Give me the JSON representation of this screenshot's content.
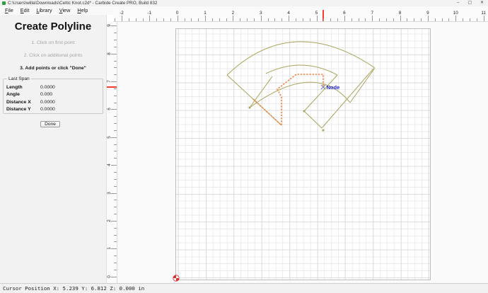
{
  "window": {
    "title": "C:\\Users\\willa\\Downloads\\Celtic Knot.c2d* - Carbide Create PRO, Build 832",
    "minimize_glyph": "–",
    "maximize_glyph": "▢",
    "close_glyph": "✕"
  },
  "menu": {
    "items": [
      {
        "label": "File"
      },
      {
        "label": "Edit"
      },
      {
        "label": "Library"
      },
      {
        "label": "View"
      },
      {
        "label": "Help"
      }
    ]
  },
  "panel": {
    "title": "Create Polyline",
    "steps": [
      {
        "label": "1. Click on first point"
      },
      {
        "label": "2. Click on additional points"
      },
      {
        "label": "3. Add points or click \"Done\""
      }
    ],
    "last_span": {
      "title": "Last Span",
      "rows": [
        {
          "label": "Length",
          "value": "0.0000"
        },
        {
          "label": "Angle",
          "value": "0.000"
        },
        {
          "label": "Distance X",
          "value": "0.0000"
        },
        {
          "label": "Distance Y",
          "value": "0.0000"
        }
      ]
    },
    "done_button": "Done"
  },
  "rulers": {
    "horizontal_labels": [
      "-2",
      "-1",
      "0",
      "1",
      "2",
      "3",
      "4",
      "5",
      "6",
      "7",
      "8",
      "9",
      "10",
      "11"
    ],
    "vertical_labels": [
      "9",
      "8",
      "7",
      "6",
      "5",
      "4",
      "3",
      "2",
      "1",
      "0"
    ],
    "marker_color": "#ff3b30"
  },
  "canvas": {
    "node_label": "Node",
    "colors": {
      "vector": "#a9a55e",
      "polyline": "#ef8544",
      "node_text": "#1f1fd3",
      "grid_minor": "#ebebeb",
      "grid_major": "#dddddd",
      "origin_marker": "#e03030"
    }
  },
  "status": {
    "text": "Cursor Position X: 5.239 Y: 6.812 Z: 0.000 in"
  }
}
